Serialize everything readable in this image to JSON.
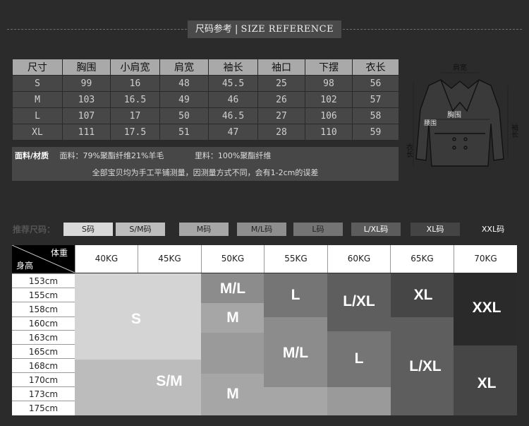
{
  "header": {
    "cn": "尺码参考",
    "sep": "|",
    "en": "SIZE REFERENCE"
  },
  "size_table": {
    "columns": [
      "尺寸",
      "胸围",
      "小肩宽",
      "肩宽",
      "袖长",
      "袖口",
      "下摆",
      "衣长"
    ],
    "rows": [
      [
        "S",
        "99",
        "16",
        "48",
        "45.5",
        "25",
        "98",
        "56"
      ],
      [
        "M",
        "103",
        "16.5",
        "49",
        "46",
        "26",
        "102",
        "57"
      ],
      [
        "L",
        "107",
        "17",
        "50",
        "46.5",
        "27",
        "106",
        "58"
      ],
      [
        "XL",
        "111",
        "17.5",
        "51",
        "47",
        "28",
        "110",
        "59"
      ]
    ],
    "material_label": "面料/材质",
    "fabric": "面料：79%聚酯纤维21%羊毛",
    "lining": "里料：100%聚酯纤维",
    "note": "全部宝贝均为手工平铺测量，因测量方式不同，会有1-2cm的误差"
  },
  "coat_labels": {
    "shoulder": "肩宽",
    "chest": "胸围",
    "waist": "腰围",
    "length": "衣长",
    "sleeve": "袖长"
  },
  "recommend": {
    "label": "推荐尺码：",
    "sizes": [
      "S码",
      "S/M码",
      "M码",
      "M/L码",
      "L码",
      "L/XL码",
      "XL码",
      "XXL码"
    ],
    "colors": [
      "#d9d9d9",
      "#bdbdbd",
      "#a6a6a6",
      "#8e8e8e",
      "#747474",
      "#5c5c5c",
      "#444444",
      "#2b2b2b"
    ]
  },
  "grid": {
    "weight_label": "体重",
    "height_label": "身高",
    "weights": [
      "40KG",
      "45KG",
      "50KG",
      "55KG",
      "60KG",
      "65KG",
      "70KG"
    ],
    "heights": [
      "153cm",
      "155cm",
      "158cm",
      "160cm",
      "163cm",
      "165cm",
      "168cm",
      "170cm",
      "173cm",
      "175cm"
    ],
    "blocks": [
      {
        "label": "S",
        "color": "#d4d4d4"
      },
      {
        "label": "S/M",
        "color": "#bcbcbc"
      },
      {
        "label": "M/L",
        "color": "#8c8c8c"
      },
      {
        "label": "M",
        "color": "#a6a6a6"
      },
      {
        "label": "M",
        "color": "#a6a6a6"
      },
      {
        "label": "L",
        "color": "#757575"
      },
      {
        "label": "M/L",
        "color": "#8c8c8c"
      },
      {
        "label": "L/XL",
        "color": "#5e5e5e"
      },
      {
        "label": "L",
        "color": "#757575"
      },
      {
        "label": "XL",
        "color": "#464646"
      },
      {
        "label": "L/XL",
        "color": "#5e5e5e"
      },
      {
        "label": "XXL",
        "color": "#2a2a2a"
      },
      {
        "label": "XL",
        "color": "#464646"
      }
    ]
  }
}
